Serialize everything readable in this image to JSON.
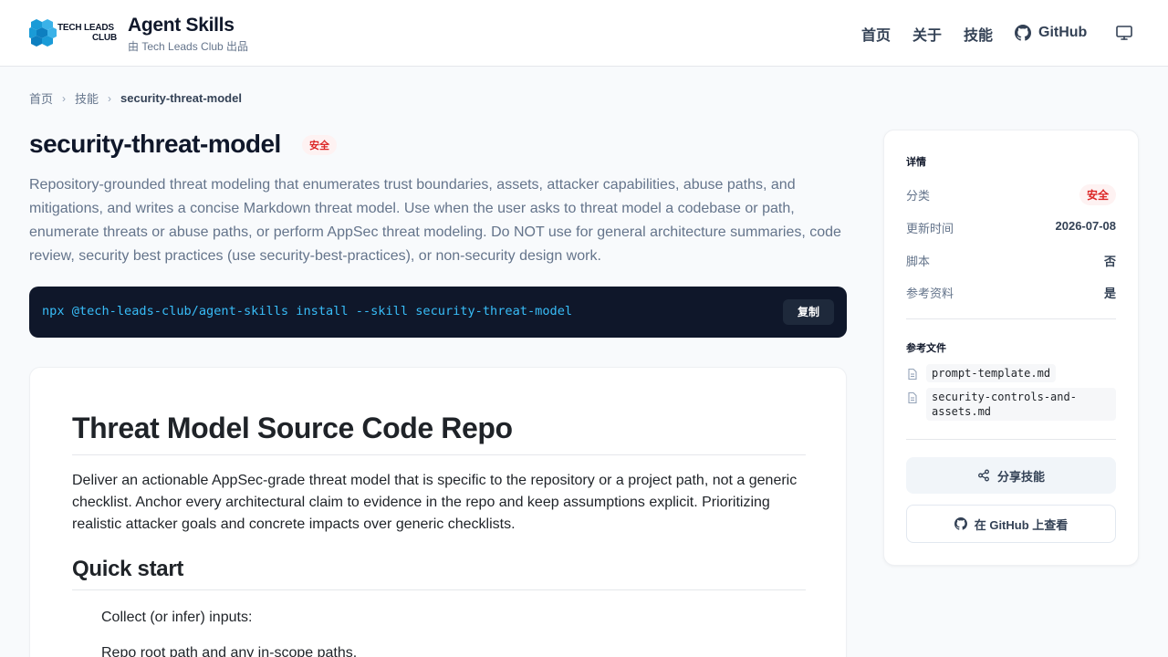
{
  "header": {
    "logo_line1": "TECH LEADS",
    "logo_line2": "CLUB",
    "title": "Agent Skills",
    "subtitle": "由 Tech Leads Club 出品",
    "nav": [
      {
        "label": "首页"
      },
      {
        "label": "关于"
      },
      {
        "label": "技能"
      }
    ],
    "github_label": "GitHub",
    "icons": {
      "logo": "cube-cluster-logo-icon",
      "github": "github-icon",
      "display": "monitor-icon"
    },
    "colors": {
      "logo_blue": "#1a9bd7"
    }
  },
  "breadcrumb": {
    "items": [
      "首页",
      "技能"
    ],
    "current": "security-threat-model",
    "separator": "›"
  },
  "skill": {
    "name": "security-threat-model",
    "category_badge": "安全",
    "description": "Repository-grounded threat modeling that enumerates trust boundaries, assets, attacker capabilities, abuse paths, and mitigations, and writes a concise Markdown threat model. Use when the user asks to threat model a codebase or path, enumerate threats or abuse paths, or perform AppSec threat modeling. Do NOT use for general architecture summaries, code review, security best practices (use security-best-practices), or non-security design work.",
    "install_command": "npx @tech-leads-club/agent-skills install --skill security-threat-model",
    "copy_label": "复制"
  },
  "doc": {
    "h1": "Threat Model Source Code Repo",
    "intro": "Deliver an actionable AppSec-grade threat model that is specific to the repository or a project path, not a generic checklist. Anchor every architectural claim to evidence in the repo and keep assumptions explicit. Prioritizing realistic attacker goals and concrete impacts over generic checklists.",
    "h2": "Quick start",
    "items": [
      "Collect (or infer) inputs:",
      "Repo root path and any in-scope paths."
    ]
  },
  "sidebar": {
    "details_title": "详情",
    "rows": [
      {
        "key": "分类",
        "value": "安全"
      },
      {
        "key": "更新时间",
        "value": "2026-07-08"
      },
      {
        "key": "脚本",
        "value": "否"
      },
      {
        "key": "参考资料",
        "value": "是"
      }
    ],
    "refs_title": "参考文件",
    "refs": [
      "prompt-template.md",
      "security-controls-and-assets.md"
    ],
    "share_label": "分享技能",
    "github_label": "在 GitHub 上查看",
    "colors": {
      "badge_bg": "#fef2f2",
      "badge_text": "#dc2626"
    }
  }
}
